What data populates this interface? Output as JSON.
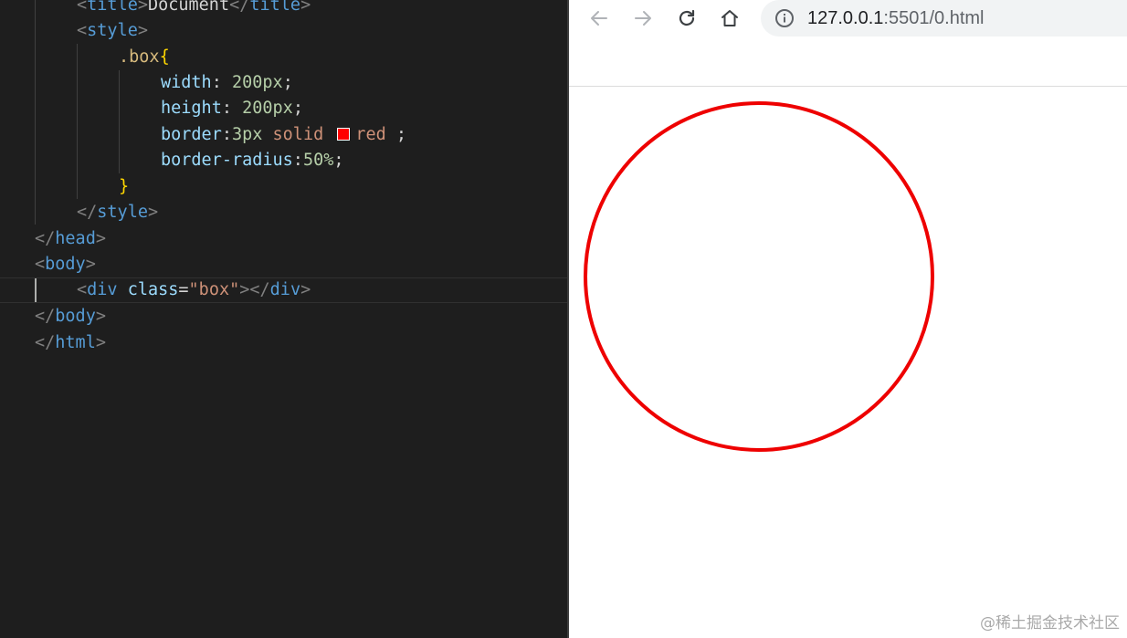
{
  "editor": {
    "lines": {
      "l1": {
        "open": "<",
        "tag": "title",
        "close": ">",
        "text": "Document",
        "end_open": "</",
        "end_tag": "title",
        "end_close": ">"
      },
      "l2": {
        "open": "<",
        "tag": "style",
        "close": ">"
      },
      "l3": {
        "selector": ".box",
        "brace": "{"
      },
      "l4": {
        "prop": "width",
        "sep": ": ",
        "value": "200px",
        "semi": ";"
      },
      "l5": {
        "prop": "height",
        "sep": ": ",
        "value": "200px",
        "semi": ";"
      },
      "l6": {
        "prop": "border",
        "sep": ":",
        "value": "3px",
        "kw": "solid",
        "color": "red",
        "semi": " ;"
      },
      "l7": {
        "prop": "border-radius",
        "sep": ":",
        "value": "50%",
        "semi": ";"
      },
      "l8": {
        "brace": "}"
      },
      "l9": {
        "open": "</",
        "tag": "style",
        "close": ">"
      },
      "l10": {
        "open": "</",
        "tag": "head",
        "close": ">"
      },
      "l11": {
        "open": "<",
        "tag": "body",
        "close": ">"
      },
      "l12": {
        "open": "<",
        "tag": "div",
        "attr": "class",
        "eq": "=",
        "str": "\"box\"",
        "close": ">",
        "end_open": "</",
        "end_tag": "div",
        "end_close": ">"
      },
      "l13": {
        "open": "</",
        "tag": "body",
        "close": ">"
      },
      "l14": {
        "open": "</",
        "tag": "html",
        "close": ">"
      }
    },
    "swatch_color": "#ff0000"
  },
  "browser": {
    "back_icon": "arrow-left-icon",
    "forward_icon": "arrow-right-icon",
    "reload_icon": "reload-icon",
    "home_icon": "home-icon",
    "info_icon": "info-icon",
    "url_host": "127.0.0.1",
    "url_path": ":5501/0.html",
    "circle_color": "#ee0000"
  },
  "watermark": "@稀土掘金技术社区"
}
